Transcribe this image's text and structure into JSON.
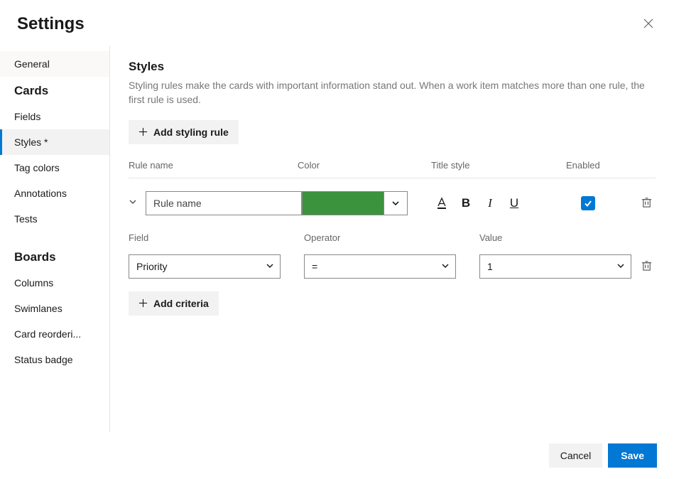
{
  "header": {
    "title": "Settings"
  },
  "sidebar": {
    "general": "General",
    "section_cards": "Cards",
    "cards_items": {
      "fields": "Fields",
      "styles": "Styles *",
      "tag_colors": "Tag colors",
      "annotations": "Annotations",
      "tests": "Tests"
    },
    "section_boards": "Boards",
    "boards_items": {
      "columns": "Columns",
      "swimlanes": "Swimlanes",
      "card_reordering": "Card reorderi...",
      "status_badge": "Status badge"
    }
  },
  "content": {
    "title": "Styles",
    "description": "Styling rules make the cards with important information stand out. When a work item matches more than one rule, the first rule is used.",
    "add_rule_label": "Add styling rule",
    "columns": {
      "name": "Rule name",
      "color": "Color",
      "title_style": "Title style",
      "enabled": "Enabled"
    },
    "rule": {
      "name_value": "Rule name",
      "color_hex": "#3b933e",
      "enabled": true
    },
    "criteria": {
      "columns": {
        "field": "Field",
        "operator": "Operator",
        "value": "Value"
      },
      "row": {
        "field": "Priority",
        "operator": "=",
        "value": "1"
      },
      "add_label": "Add criteria"
    }
  },
  "footer": {
    "cancel": "Cancel",
    "save": "Save"
  }
}
